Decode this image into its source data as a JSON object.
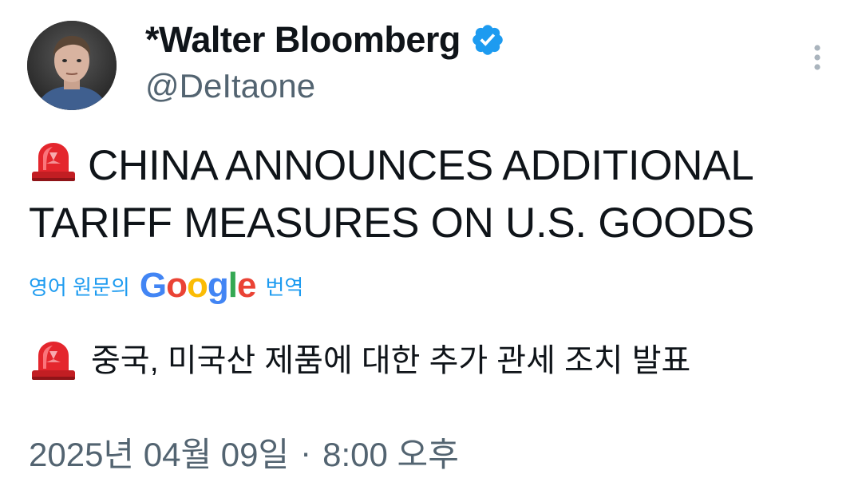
{
  "author": {
    "display_name": "*Walter Bloomberg",
    "handle": "@DeItaone",
    "verified": true
  },
  "tweet": {
    "text": "CHINA ANNOUNCES ADDITIONAL TARIFF MEASURES ON U.S. GOODS",
    "emoji": "rotating-light-icon"
  },
  "translation": {
    "label_prefix": "영어 원문의",
    "provider": "Google",
    "label_suffix": "번역",
    "text": "중국, 미국산 제품에 대한 추가 관세 조치 발표"
  },
  "timestamp": {
    "date": "2025년 04월 09일",
    "separator": "·",
    "time": "8:00 오후"
  },
  "colors": {
    "text_primary": "#0f1419",
    "text_secondary": "#536471",
    "link": "#1d9bf0",
    "verified": "#1d9bf0"
  }
}
